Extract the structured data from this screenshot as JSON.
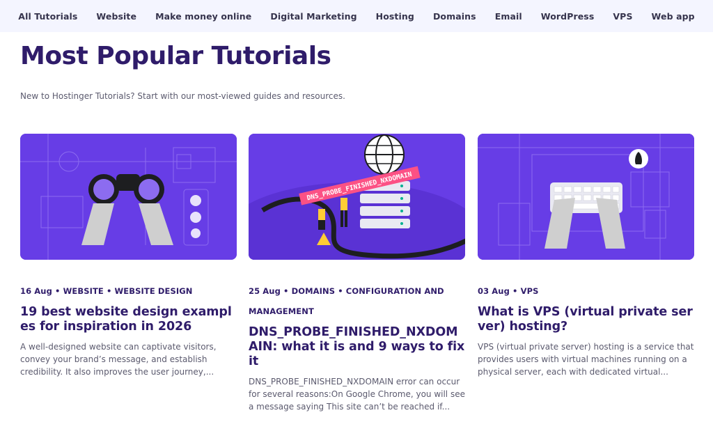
{
  "nav": {
    "items": [
      "All Tutorials",
      "Website",
      "Make money online",
      "Digital Marketing",
      "Hosting",
      "Domains",
      "Email",
      "WordPress",
      "VPS",
      "Web app"
    ]
  },
  "hero": {
    "title": "Most Popular Tutorials",
    "subtitle": "New to Hostinger Tutorials? Start with our most-viewed guides and resources."
  },
  "cards": [
    {
      "meta": "16 Aug • WEBSITE • WEBSITE DESIGN",
      "title": "19 best website design examples for inspiration in 2026",
      "excerpt": "A well-designed website can captivate visitors, convey your brand’s message, and establish credibility. It also improves the user journey,...",
      "image_icon": "binoculars-illustration"
    },
    {
      "meta": "25 Aug • DOMAINS • CONFIGURATION AND MANAGEMENT",
      "title": "DNS_PROBE_FINISHED_NXDOMAIN: what it is and 9 ways to fix it",
      "excerpt": "DNS_PROBE_FINISHED_NXDOMAIN error can occur for several reasons:On Google Chrome, you will see a message saying This site can’t be reached if...",
      "image_label": "DNS_PROBE_FINISHED_NXDOMAIN",
      "image_icon": "globe-server-illustration"
    },
    {
      "meta": "03 Aug • VPS",
      "title": "What is VPS (virtual private server) hosting?",
      "excerpt": "VPS (virtual private server) hosting is a service that provides users with virtual machines running on a physical server, each with dedicated virtual...",
      "image_icon": "keyboard-illustration"
    }
  ],
  "colors": {
    "accent": "#673de6",
    "heading": "#2f1c6a",
    "nav_bg": "#f4f5ff",
    "label_pink": "#fc5185"
  }
}
